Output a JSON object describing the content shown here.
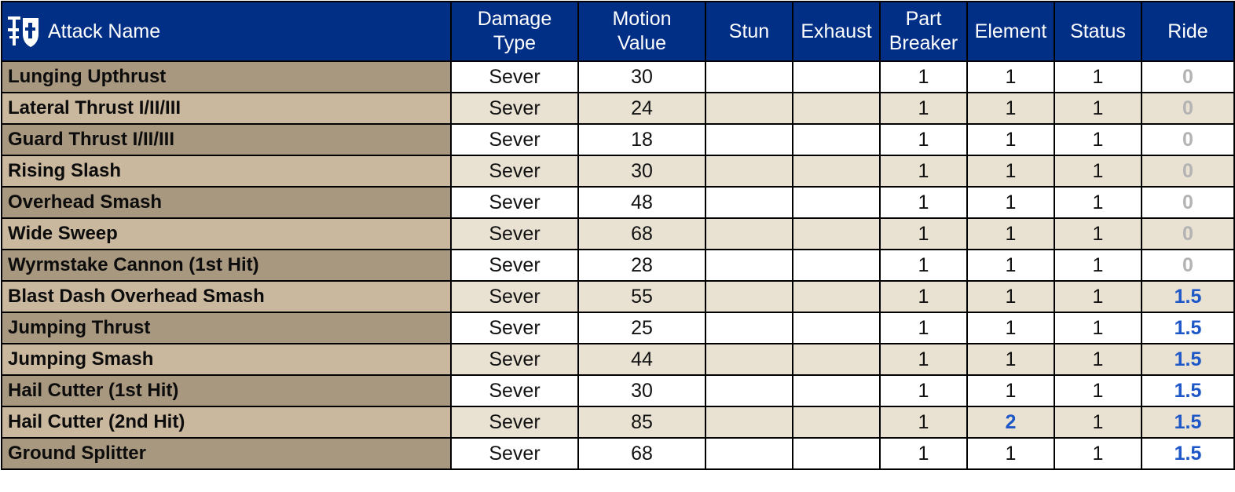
{
  "icon": "lance-shield-icon",
  "colors": {
    "header_bg": "#002f85",
    "name_odd": "#a89880",
    "name_even": "#c9b79e",
    "row_even": "#e9e2d3",
    "highlight": "#1d57c7",
    "zero": "#b3b3b3"
  },
  "headers": {
    "attack_name": "Attack Name",
    "damage_type": [
      "Damage",
      "Type"
    ],
    "motion_value": [
      "Motion",
      "Value"
    ],
    "stun": "Stun",
    "exhaust": "Exhaust",
    "part_breaker": [
      "Part",
      "Breaker"
    ],
    "element": "Element",
    "status": "Status",
    "ride": "Ride"
  },
  "rows": [
    {
      "name": "Lunging Upthrust",
      "damage_type": "Sever",
      "motion_value": "30",
      "stun": "",
      "exhaust": "",
      "part_breaker": "1",
      "element": "1",
      "status": "1",
      "ride": "0"
    },
    {
      "name": "Lateral Thrust I/II/III",
      "damage_type": "Sever",
      "motion_value": "24",
      "stun": "",
      "exhaust": "",
      "part_breaker": "1",
      "element": "1",
      "status": "1",
      "ride": "0"
    },
    {
      "name": "Guard Thrust I/II/III",
      "damage_type": "Sever",
      "motion_value": "18",
      "stun": "",
      "exhaust": "",
      "part_breaker": "1",
      "element": "1",
      "status": "1",
      "ride": "0"
    },
    {
      "name": "Rising Slash",
      "damage_type": "Sever",
      "motion_value": "30",
      "stun": "",
      "exhaust": "",
      "part_breaker": "1",
      "element": "1",
      "status": "1",
      "ride": "0"
    },
    {
      "name": "Overhead Smash",
      "damage_type": "Sever",
      "motion_value": "48",
      "stun": "",
      "exhaust": "",
      "part_breaker": "1",
      "element": "1",
      "status": "1",
      "ride": "0"
    },
    {
      "name": "Wide Sweep",
      "damage_type": "Sever",
      "motion_value": "68",
      "stun": "",
      "exhaust": "",
      "part_breaker": "1",
      "element": "1",
      "status": "1",
      "ride": "0"
    },
    {
      "name": "Wyrmstake Cannon (1st Hit)",
      "damage_type": "Sever",
      "motion_value": "28",
      "stun": "",
      "exhaust": "",
      "part_breaker": "1",
      "element": "1",
      "status": "1",
      "ride": "0"
    },
    {
      "name": "Blast Dash Overhead Smash",
      "damage_type": "Sever",
      "motion_value": "55",
      "stun": "",
      "exhaust": "",
      "part_breaker": "1",
      "element": "1",
      "status": "1",
      "ride": "1.5"
    },
    {
      "name": "Jumping Thrust",
      "damage_type": "Sever",
      "motion_value": "25",
      "stun": "",
      "exhaust": "",
      "part_breaker": "1",
      "element": "1",
      "status": "1",
      "ride": "1.5"
    },
    {
      "name": "Jumping Smash",
      "damage_type": "Sever",
      "motion_value": "44",
      "stun": "",
      "exhaust": "",
      "part_breaker": "1",
      "element": "1",
      "status": "1",
      "ride": "1.5"
    },
    {
      "name": "Hail Cutter (1st Hit)",
      "damage_type": "Sever",
      "motion_value": "30",
      "stun": "",
      "exhaust": "",
      "part_breaker": "1",
      "element": "1",
      "status": "1",
      "ride": "1.5"
    },
    {
      "name": "Hail Cutter (2nd Hit)",
      "damage_type": "Sever",
      "motion_value": "85",
      "stun": "",
      "exhaust": "",
      "part_breaker": "1",
      "element": "2",
      "status": "1",
      "ride": "1.5"
    },
    {
      "name": "Ground Splitter",
      "damage_type": "Sever",
      "motion_value": "68",
      "stun": "",
      "exhaust": "",
      "part_breaker": "1",
      "element": "1",
      "status": "1",
      "ride": "1.5"
    }
  ]
}
